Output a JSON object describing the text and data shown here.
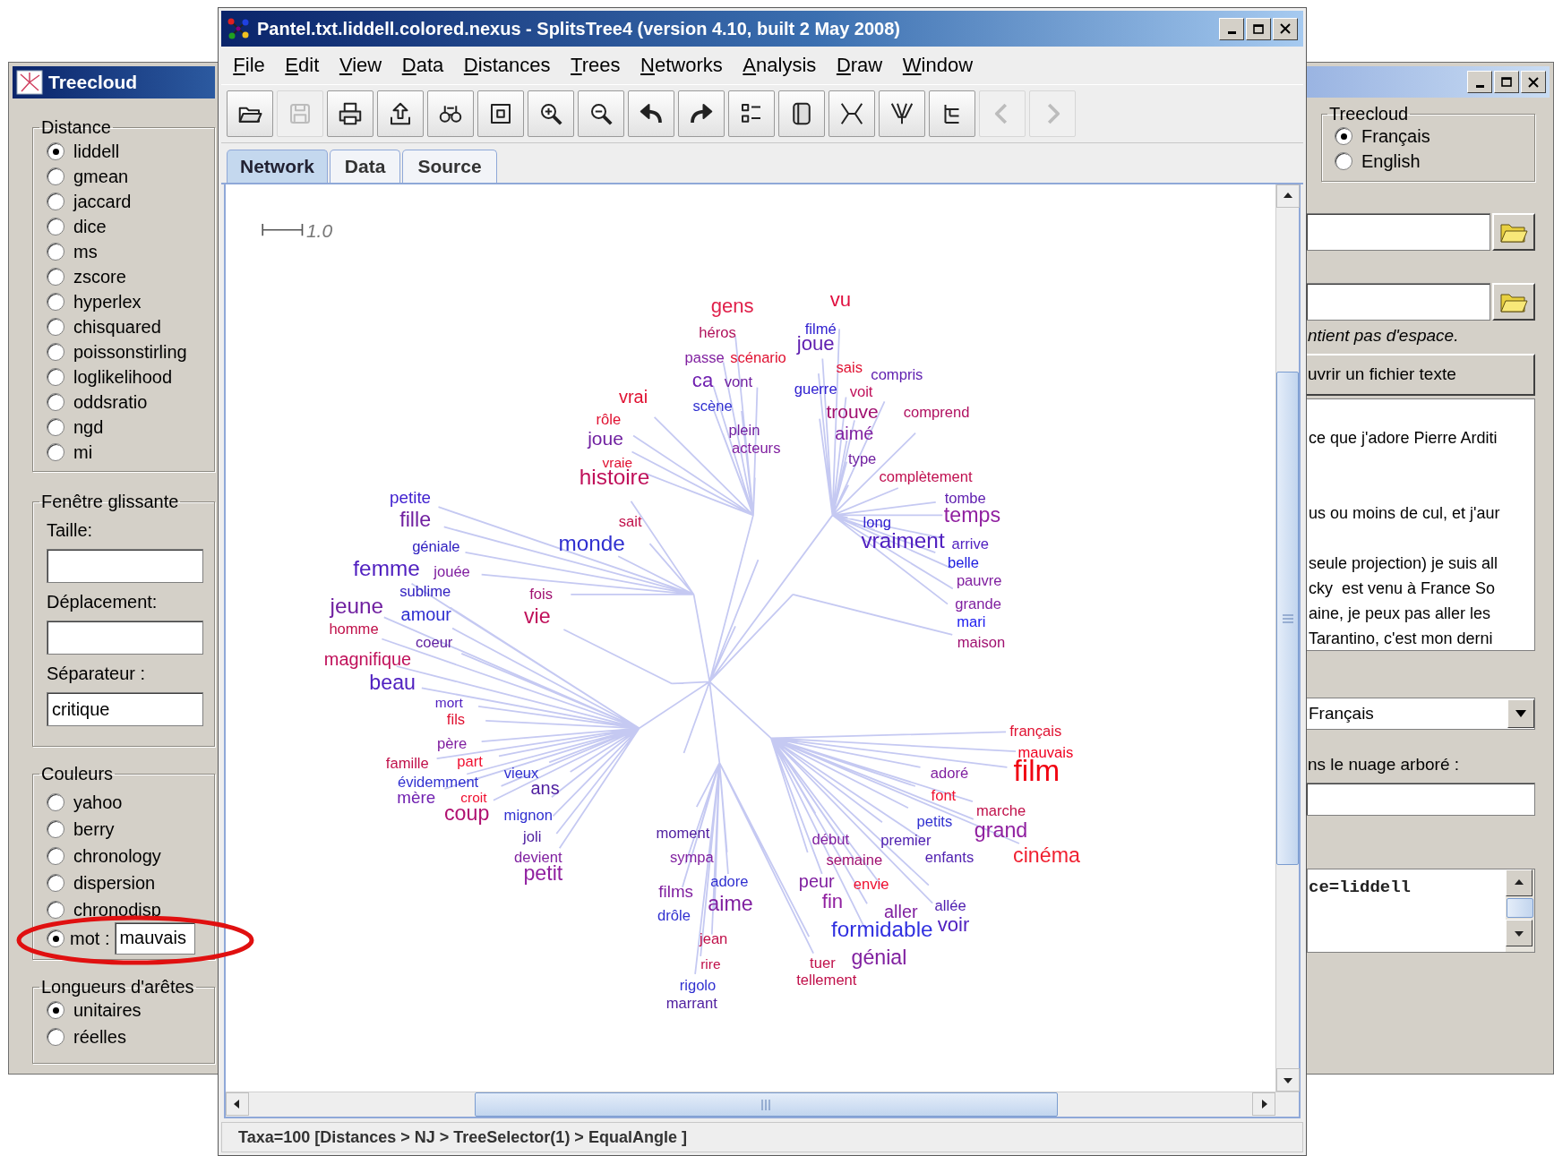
{
  "left_window": {
    "title": "Treecloud",
    "distance": {
      "legend": "Distance",
      "options": [
        {
          "label": "liddell",
          "selected": true
        },
        {
          "label": "gmean",
          "selected": false
        },
        {
          "label": "jaccard",
          "selected": false
        },
        {
          "label": "dice",
          "selected": false
        },
        {
          "label": "ms",
          "selected": false
        },
        {
          "label": "zscore",
          "selected": false
        },
        {
          "label": "hyperlex",
          "selected": false
        },
        {
          "label": "chisquared",
          "selected": false
        },
        {
          "label": "poissonstirling",
          "selected": false
        },
        {
          "label": "loglikelihood",
          "selected": false
        },
        {
          "label": "oddsratio",
          "selected": false
        },
        {
          "label": "ngd",
          "selected": false
        },
        {
          "label": "mi",
          "selected": false
        }
      ]
    },
    "sliding_window": {
      "legend": "Fenêtre glissante",
      "fields": [
        {
          "label": "Taille:"
        },
        {
          "label": "Déplacement:"
        },
        {
          "label": "Séparateur :",
          "value": "critique"
        }
      ]
    },
    "colors": {
      "legend": "Couleurs",
      "options": [
        {
          "kind": "radio",
          "label": "yahoo",
          "selected": false
        },
        {
          "kind": "radio",
          "label": "berry",
          "selected": false
        },
        {
          "kind": "radio",
          "label": "chronology",
          "selected": false
        },
        {
          "kind": "radio",
          "label": "dispersion",
          "selected": false
        },
        {
          "kind": "radio",
          "label": "chronodisp",
          "selected": false
        },
        {
          "kind": "radio_field",
          "label": "mot :",
          "selected": true,
          "value": "mauvais"
        }
      ]
    },
    "edge_lengths": {
      "legend": "Longueurs d'arêtes",
      "options": [
        {
          "label": "unitaires",
          "selected": true
        },
        {
          "label": "réelles",
          "selected": false
        }
      ]
    }
  },
  "main_window": {
    "title": "Pantel.txt.liddell.colored.nexus - SplitsTree4 (version 4.10, built 2 May 2008)",
    "menu": [
      "File",
      "Edit",
      "View",
      "Data",
      "Distances",
      "Trees",
      "Networks",
      "Analysis",
      "Draw",
      "Window"
    ],
    "toolbar": [
      {
        "disabled": false
      },
      {
        "disabled": true
      },
      {
        "disabled": false
      },
      {
        "disabled": false
      },
      {
        "disabled": false
      },
      {
        "disabled": false
      },
      {
        "disabled": false
      },
      {
        "disabled": false
      },
      {
        "disabled": false
      },
      {
        "disabled": false
      },
      {
        "disabled": false
      },
      {
        "disabled": false
      },
      {
        "disabled": false
      },
      {
        "disabled": false
      },
      {
        "disabled": false
      },
      {
        "disabled": true
      },
      {
        "disabled": true
      }
    ],
    "tabs": [
      {
        "label": "Network",
        "selected": true
      },
      {
        "label": "Data",
        "selected": false
      },
      {
        "label": "Source",
        "selected": false
      }
    ],
    "scale_label": "1.0",
    "words": [
      {
        "text": "gens",
        "color": "#e0204a"
      },
      {
        "text": "vu",
        "color": "#e01040"
      },
      {
        "text": "héros",
        "color": "#b0105a"
      },
      {
        "text": "filmé",
        "color": "#3020d0"
      },
      {
        "text": "joue",
        "color": "#6020b0"
      },
      {
        "text": "passe",
        "color": "#8020a0"
      },
      {
        "text": "scénario",
        "color": "#e01030"
      },
      {
        "text": "vrai",
        "color": "#e01030"
      },
      {
        "text": "ca",
        "color": "#7020b0"
      },
      {
        "text": "vont",
        "color": "#7020a0"
      },
      {
        "text": "guerre",
        "color": "#3020d0"
      },
      {
        "text": "sais",
        "color": "#e01030"
      },
      {
        "text": "voit",
        "color": "#c0105a"
      },
      {
        "text": "compris",
        "color": "#6020b0"
      },
      {
        "text": "rôle",
        "color": "#e01030"
      },
      {
        "text": "scène",
        "color": "#3030d0"
      },
      {
        "text": "trouve",
        "color": "#a01070"
      },
      {
        "text": "comprend",
        "color": "#b01060"
      },
      {
        "text": "joue",
        "color": "#7020a0"
      },
      {
        "text": "plein",
        "color": "#7020a0"
      },
      {
        "text": "aimé",
        "color": "#8020a0"
      },
      {
        "text": "acteurs",
        "color": "#8020a0"
      },
      {
        "text": "vraie",
        "color": "#e01030"
      },
      {
        "text": "type",
        "color": "#7020a0"
      },
      {
        "text": "histoire",
        "color": "#c0105a"
      },
      {
        "text": "complètement",
        "color": "#c01050"
      },
      {
        "text": "petite",
        "color": "#4020d0"
      },
      {
        "text": "tombe",
        "color": "#6020b0"
      },
      {
        "text": "fille",
        "color": "#7020a0"
      },
      {
        "text": "sait",
        "color": "#c0104a"
      },
      {
        "text": "long",
        "color": "#3020d0"
      },
      {
        "text": "temps",
        "color": "#9020a0"
      },
      {
        "text": "géniale",
        "color": "#3020c0"
      },
      {
        "text": "monde",
        "color": "#3030d0"
      },
      {
        "text": "vraiment",
        "color": "#5020c0"
      },
      {
        "text": "arrive",
        "color": "#5020c0"
      },
      {
        "text": "femme",
        "color": "#5020c0"
      },
      {
        "text": "jouée",
        "color": "#8020a0"
      },
      {
        "text": "belle",
        "color": "#2020e0"
      },
      {
        "text": "pauvre",
        "color": "#8020a0"
      },
      {
        "text": "sublime",
        "color": "#3020c0"
      },
      {
        "text": "fois",
        "color": "#a01070"
      },
      {
        "text": "jeune",
        "color": "#7020a0"
      },
      {
        "text": "grande",
        "color": "#8020a0"
      },
      {
        "text": "homme",
        "color": "#c0104a"
      },
      {
        "text": "amour",
        "color": "#3030d0"
      },
      {
        "text": "vie",
        "color": "#c0105a"
      },
      {
        "text": "mari",
        "color": "#2020f0"
      },
      {
        "text": "coeur",
        "color": "#6020a0"
      },
      {
        "text": "maison",
        "color": "#a01070"
      },
      {
        "text": "magnifique",
        "color": "#c0105a"
      },
      {
        "text": "beau",
        "color": "#5020c0"
      },
      {
        "text": "mort",
        "color": "#5020c0"
      },
      {
        "text": "fils",
        "color": "#e01030"
      },
      {
        "text": "français",
        "color": "#e01030"
      },
      {
        "text": "père",
        "color": "#8020a0"
      },
      {
        "text": "mauvais",
        "color": "#f00020"
      },
      {
        "text": "famille",
        "color": "#c0104a"
      },
      {
        "text": "part",
        "color": "#f01030"
      },
      {
        "text": "vieux",
        "color": "#3030d0"
      },
      {
        "text": "adoré",
        "color": "#8020a0"
      },
      {
        "text": "film",
        "color": "#f00010"
      },
      {
        "text": "évidemment",
        "color": "#3030d0"
      },
      {
        "text": "ans",
        "color": "#5020a0"
      },
      {
        "text": "mère",
        "color": "#7020b0"
      },
      {
        "text": "croit",
        "color": "#f01030"
      },
      {
        "text": "font",
        "color": "#f01030"
      },
      {
        "text": "coup",
        "color": "#b01070"
      },
      {
        "text": "mignon",
        "color": "#3030d0"
      },
      {
        "text": "petits",
        "color": "#3030d0"
      },
      {
        "text": "marche",
        "color": "#c0104a"
      },
      {
        "text": "joli",
        "color": "#5020a0"
      },
      {
        "text": "moment",
        "color": "#5020a0"
      },
      {
        "text": "début",
        "color": "#8020a0"
      },
      {
        "text": "premier",
        "color": "#5020b0"
      },
      {
        "text": "grand",
        "color": "#9020a0"
      },
      {
        "text": "devient",
        "color": "#8020a0"
      },
      {
        "text": "sympa",
        "color": "#8020a0"
      },
      {
        "text": "semaine",
        "color": "#a01070"
      },
      {
        "text": "enfants",
        "color": "#5020b0"
      },
      {
        "text": "cinéma",
        "color": "#f02030"
      },
      {
        "text": "petit",
        "color": "#9020a0"
      },
      {
        "text": "films",
        "color": "#8020a0"
      },
      {
        "text": "adore",
        "color": "#3030d0"
      },
      {
        "text": "peur",
        "color": "#8020a0"
      },
      {
        "text": "envie",
        "color": "#f01030"
      },
      {
        "text": "drôle",
        "color": "#3030d0"
      },
      {
        "text": "aime",
        "color": "#8020a0"
      },
      {
        "text": "fin",
        "color": "#9020a0"
      },
      {
        "text": "aller",
        "color": "#8020a0"
      },
      {
        "text": "allée",
        "color": "#5020b0"
      },
      {
        "text": "formidable",
        "color": "#3030e0"
      },
      {
        "text": "voir",
        "color": "#5020c0"
      },
      {
        "text": "jean",
        "color": "#c0104a"
      },
      {
        "text": "rire",
        "color": "#c0104a"
      },
      {
        "text": "tuer",
        "color": "#c0104a"
      },
      {
        "text": "génial",
        "color": "#8020a0"
      },
      {
        "text": "rigolo",
        "color": "#3030d0"
      },
      {
        "text": "tellement",
        "color": "#c0104a"
      },
      {
        "text": "marrant",
        "color": "#5020a0"
      }
    ],
    "status_bar": "Taxa=100 [Distances > NJ > TreeSelector(1) > EqualAngle ]"
  },
  "right_window": {
    "language": {
      "legend": "Treecloud",
      "options": [
        {
          "label": "Français",
          "selected": true
        },
        {
          "label": "English",
          "selected": false
        }
      ]
    },
    "hint": "ntient pas d'espace.",
    "open_button": "uvrir un fichier texte",
    "text_paragraphs": [
      [
        "ce que j'adore Pierre Arditi"
      ],
      [
        "us ou moins de cul, et j'aur"
      ],
      [
        "seule projection) je suis all",
        "cky  est venu à France So",
        "aine, je peux pas aller les",
        "Tarantino, c'est mon derni"
      ]
    ],
    "dropdown": "Français",
    "field_label": "ns le nuage arboré :",
    "log_text": "ce=liddell"
  },
  "annotation_ellipse": true
}
